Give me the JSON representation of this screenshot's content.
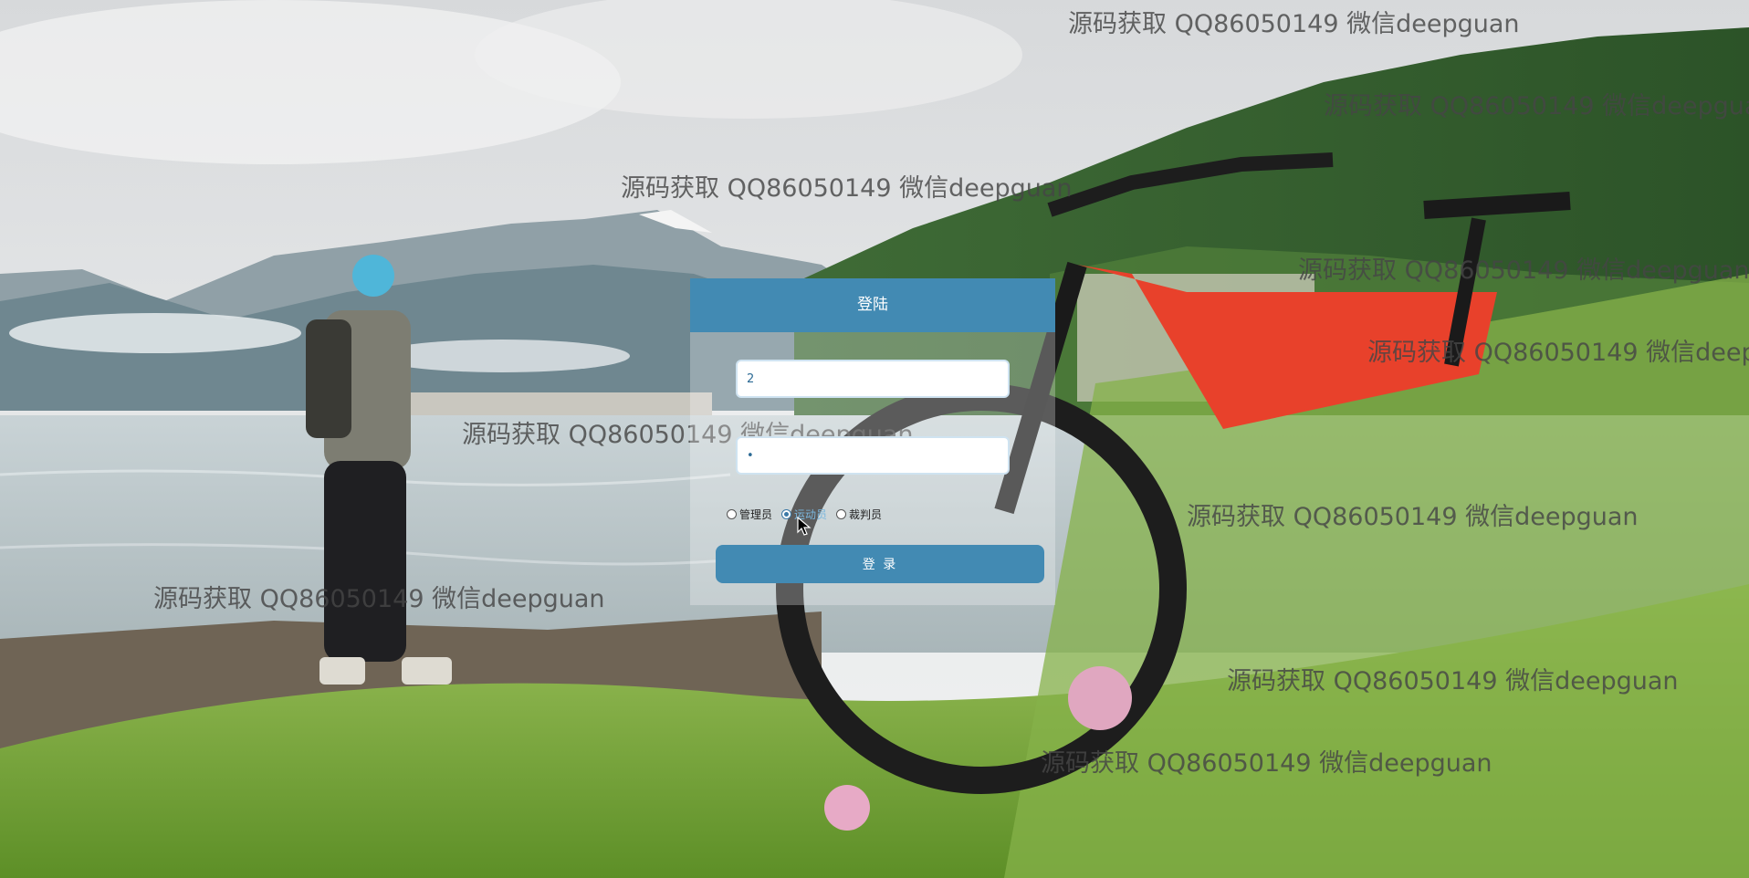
{
  "login": {
    "title": "登陆",
    "username_value": "2",
    "password_value": "•",
    "roles": [
      {
        "label": "管理员",
        "checked": false
      },
      {
        "label": "运动员",
        "checked": true
      },
      {
        "label": "裁判员",
        "checked": false
      }
    ],
    "submit_label": "登 录"
  },
  "watermark": {
    "text": "源码获取 QQ86050149 微信deepguan"
  },
  "colors": {
    "accent": "#428ab3",
    "input_border": "#cfe3f1"
  },
  "icons": {
    "cursor": "mouse-pointer-icon",
    "radio": "radio-icon"
  }
}
